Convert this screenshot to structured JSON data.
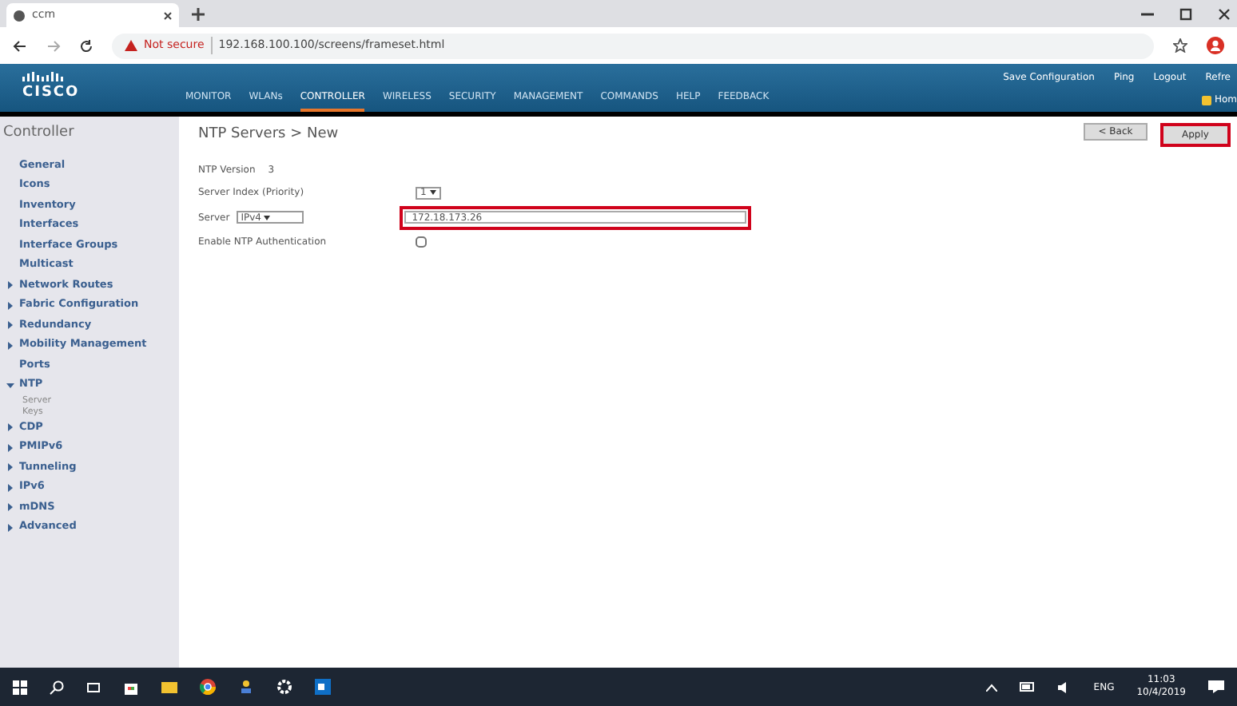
{
  "browser": {
    "tab_title": "ccm",
    "security_label": "Not secure",
    "url": "192.168.100.100/screens/frameset.html"
  },
  "header": {
    "logo": "CISCO",
    "menu": [
      {
        "label": "MONITOR",
        "selected": false
      },
      {
        "label": "WLANs",
        "selected": false
      },
      {
        "label": "CONTROLLER",
        "selected": true
      },
      {
        "label": "WIRELESS",
        "selected": false
      },
      {
        "label": "SECURITY",
        "selected": false
      },
      {
        "label": "MANAGEMENT",
        "selected": false
      },
      {
        "label": "COMMANDS",
        "selected": false
      },
      {
        "label": "HELP",
        "selected": false
      },
      {
        "label": "FEEDBACK",
        "selected": false
      }
    ],
    "top_links": [
      "Save Configuration",
      "Ping",
      "Logout",
      "Refre"
    ],
    "home": "Hom"
  },
  "sidebar": {
    "title": "Controller",
    "items": [
      {
        "label": "General",
        "kind": "plain"
      },
      {
        "label": "Icons",
        "kind": "plain"
      },
      {
        "label": "Inventory",
        "kind": "plain"
      },
      {
        "label": "Interfaces",
        "kind": "plain"
      },
      {
        "label": "Interface Groups",
        "kind": "plain"
      },
      {
        "label": "Multicast",
        "kind": "plain"
      },
      {
        "label": "Network Routes",
        "kind": "group",
        "expanded": false
      },
      {
        "label": "Fabric Configuration",
        "kind": "group",
        "expanded": false
      },
      {
        "label": "Redundancy",
        "kind": "group",
        "expanded": false
      },
      {
        "label": "Mobility Management",
        "kind": "group",
        "expanded": false
      },
      {
        "label": "Ports",
        "kind": "plain"
      },
      {
        "label": "NTP",
        "kind": "group",
        "expanded": true,
        "children": [
          {
            "label": "Server"
          },
          {
            "label": "Keys"
          }
        ]
      },
      {
        "label": "CDP",
        "kind": "group",
        "expanded": false
      },
      {
        "label": "PMIPv6",
        "kind": "group",
        "expanded": false
      },
      {
        "label": "Tunneling",
        "kind": "group",
        "expanded": false
      },
      {
        "label": "IPv6",
        "kind": "group",
        "expanded": false
      },
      {
        "label": "mDNS",
        "kind": "group",
        "expanded": false
      },
      {
        "label": "Advanced",
        "kind": "group",
        "expanded": false
      }
    ]
  },
  "page": {
    "title": "NTP Servers > New",
    "buttons": [
      {
        "label": "< Back",
        "highlighted": false
      },
      {
        "label": "Apply",
        "highlighted": true
      }
    ],
    "form": {
      "ntp_version_label": "NTP Version",
      "ntp_version": "3",
      "index_label": "Server Index (Priority)",
      "index_value": "1",
      "server_label": "Server",
      "server_type": "IPv4",
      "server_address": "172.18.173.26",
      "auth_label": "Enable NTP Authentication",
      "auth_checked": false
    }
  },
  "taskbar": {
    "language": "ENG",
    "time": "11:03",
    "date": "10/4/2019"
  }
}
